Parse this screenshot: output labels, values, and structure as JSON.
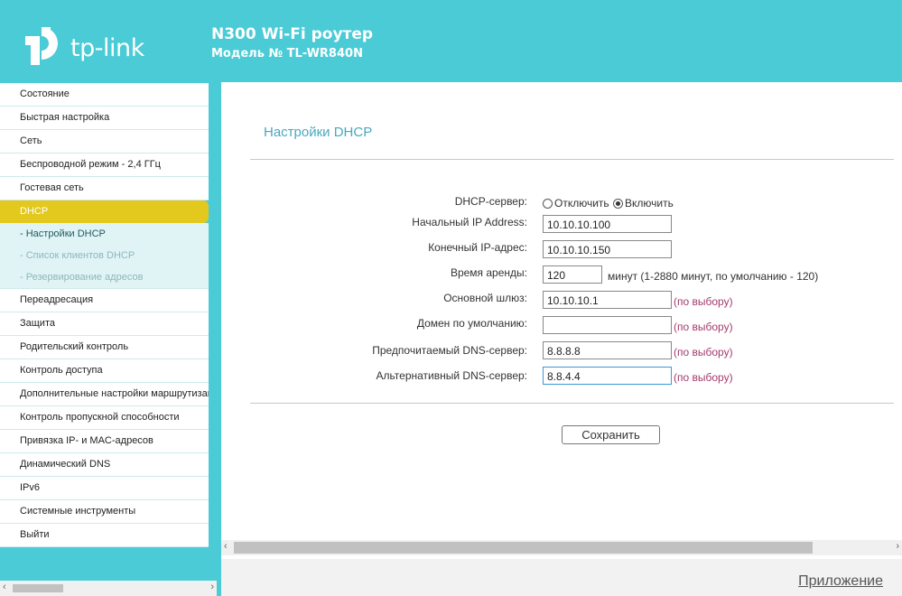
{
  "header": {
    "brand": "tp-link",
    "title": "N300 Wi-Fi роутер",
    "model": "Модель № TL-WR840N",
    "logo_icon": "tp-link-logo-icon"
  },
  "sidebar": {
    "items_top": [
      "Состояние",
      "Быстрая настройка",
      "Сеть",
      "Беспроводной режим - 2,4 ГГц",
      "Гостевая сеть"
    ],
    "active": "DHCP",
    "sub_items": [
      "- Настройки DHCP",
      "- Список клиентов DHCP",
      "- Резервирование адресов"
    ],
    "items_bottom": [
      "Переадресация",
      "Защита",
      "Родительский контроль",
      "Контроль доступа",
      "Дополнительные настройки маршрутизации",
      "Контроль пропускной способности",
      "Привязка IP- и MAC-адресов",
      "Динамический DNS",
      "IPv6",
      "Системные инструменты",
      "Выйти"
    ]
  },
  "main": {
    "title": "Настройки DHCP",
    "dhcp_server_label": "DHCP-сервер:",
    "radio_off": "Отключить",
    "radio_on": "Включить",
    "radio_selected": "Включить",
    "start_ip_label": "Начальный IP Address:",
    "start_ip": "10.10.10.100",
    "end_ip_label": "Конечный IP-адрес:",
    "end_ip": "10.10.10.150",
    "lease_label": "Время аренды:",
    "lease": "120",
    "lease_note": "минут (1-2880 минут, по умолчанию - 120)",
    "gateway_label": "Основной шлюз:",
    "gateway": "10.10.10.1",
    "domain_label": "Домен по умолчанию:",
    "domain": "",
    "dns1_label": "Предпочитаемый DNS-сервер:",
    "dns1": "8.8.8.8",
    "dns2_label": "Альтернативный DNS-сервер:",
    "dns2": "8.8.4.4",
    "optional": "(по выбору)",
    "save": "Сохранить"
  },
  "footer": {
    "app_link": "Приложение"
  },
  "colors": {
    "accent": "#4acbd6",
    "active_menu": "#e3c91e",
    "optional_text": "#a33a6e",
    "title": "#4aa8c0"
  }
}
